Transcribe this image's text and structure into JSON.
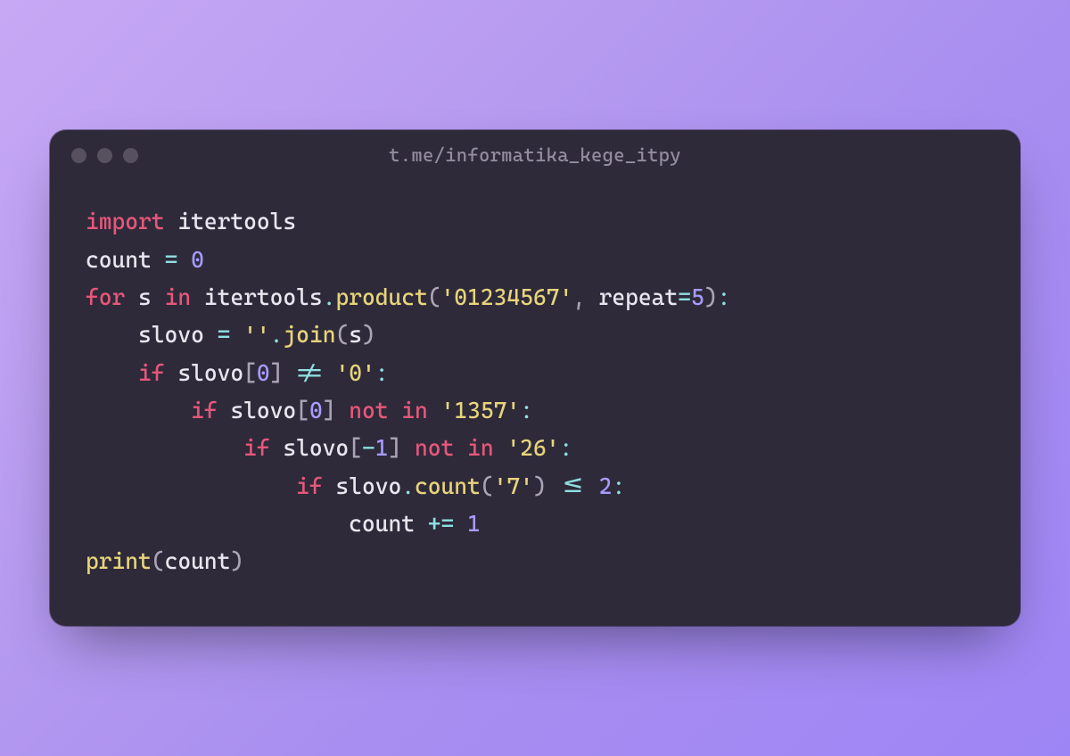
{
  "window": {
    "title": "t.me/informatika_kege_itpy"
  },
  "code": {
    "tokens": [
      [
        [
          "import",
          "kw"
        ],
        [
          " itertools",
          "id"
        ]
      ],
      [
        [
          "count ",
          "id"
        ],
        [
          "=",
          "op"
        ],
        [
          " ",
          "id"
        ],
        [
          "0",
          "num"
        ]
      ],
      [
        [
          "for",
          "kw"
        ],
        [
          " s ",
          "id"
        ],
        [
          "in",
          "kw"
        ],
        [
          " itertools",
          "id"
        ],
        [
          ".",
          "op"
        ],
        [
          "product",
          "fn"
        ],
        [
          "(",
          "par"
        ],
        [
          "'01234567'",
          "str"
        ],
        [
          ",",
          "par"
        ],
        [
          " repeat",
          "attr"
        ],
        [
          "=",
          "op"
        ],
        [
          "5",
          "num"
        ],
        [
          ")",
          "par"
        ],
        [
          ":",
          "op"
        ]
      ],
      [
        [
          "    slovo ",
          "id"
        ],
        [
          "=",
          "op"
        ],
        [
          " ",
          "id"
        ],
        [
          "''",
          "str"
        ],
        [
          ".",
          "op"
        ],
        [
          "join",
          "fn"
        ],
        [
          "(",
          "par"
        ],
        [
          "s",
          "id"
        ],
        [
          ")",
          "par"
        ]
      ],
      [
        [
          "    ",
          "id"
        ],
        [
          "if",
          "kw"
        ],
        [
          " slovo",
          "id"
        ],
        [
          "[",
          "par"
        ],
        [
          "0",
          "num"
        ],
        [
          "]",
          "par"
        ],
        [
          " ",
          "id"
        ],
        [
          "!=",
          "op"
        ],
        [
          " ",
          "id"
        ],
        [
          "'0'",
          "str"
        ],
        [
          ":",
          "op"
        ]
      ],
      [
        [
          "        ",
          "id"
        ],
        [
          "if",
          "kw"
        ],
        [
          " slovo",
          "id"
        ],
        [
          "[",
          "par"
        ],
        [
          "0",
          "num"
        ],
        [
          "]",
          "par"
        ],
        [
          " ",
          "id"
        ],
        [
          "not in",
          "kw"
        ],
        [
          " ",
          "id"
        ],
        [
          "'1357'",
          "str"
        ],
        [
          ":",
          "op"
        ]
      ],
      [
        [
          "            ",
          "id"
        ],
        [
          "if",
          "kw"
        ],
        [
          " slovo",
          "id"
        ],
        [
          "[",
          "par"
        ],
        [
          "-",
          "op"
        ],
        [
          "1",
          "num"
        ],
        [
          "]",
          "par"
        ],
        [
          " ",
          "id"
        ],
        [
          "not in",
          "kw"
        ],
        [
          " ",
          "id"
        ],
        [
          "'26'",
          "str"
        ],
        [
          ":",
          "op"
        ]
      ],
      [
        [
          "                ",
          "id"
        ],
        [
          "if",
          "kw"
        ],
        [
          " slovo",
          "id"
        ],
        [
          ".",
          "op"
        ],
        [
          "count",
          "fn"
        ],
        [
          "(",
          "par"
        ],
        [
          "'7'",
          "str"
        ],
        [
          ")",
          "par"
        ],
        [
          " ",
          "id"
        ],
        [
          "<=",
          "op"
        ],
        [
          " ",
          "id"
        ],
        [
          "2",
          "num"
        ],
        [
          ":",
          "op"
        ]
      ],
      [
        [
          "                    count ",
          "id"
        ],
        [
          "+=",
          "op"
        ],
        [
          " ",
          "id"
        ],
        [
          "1",
          "num"
        ]
      ],
      [
        [
          "print",
          "fn"
        ],
        [
          "(",
          "par"
        ],
        [
          "count",
          "id"
        ],
        [
          ")",
          "par"
        ]
      ]
    ]
  }
}
